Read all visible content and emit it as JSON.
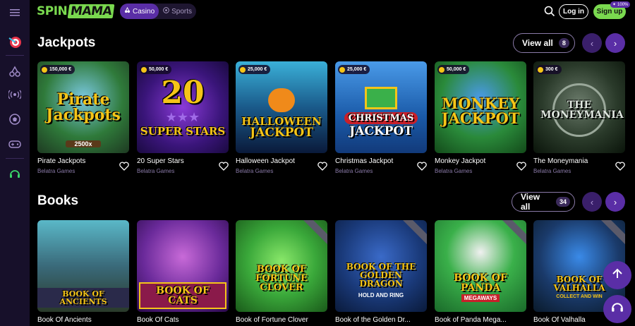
{
  "header": {
    "logo": {
      "part1": "SPIN",
      "part2": "MAMA"
    },
    "tabs": [
      {
        "label": "Casino",
        "icon": "casino-icon",
        "active": true
      },
      {
        "label": "Sports",
        "icon": "soccer-ball-icon",
        "active": false
      }
    ],
    "login_label": "Log in",
    "signup_label": "Sign up",
    "signup_badge": "100%"
  },
  "sidebar": {
    "items": [
      {
        "icon": "menu-icon"
      },
      {
        "icon": "target-icon"
      },
      {
        "icon": "cherries-icon"
      },
      {
        "icon": "live-broadcast-icon"
      },
      {
        "icon": "soccer-ball-icon"
      },
      {
        "icon": "gamepad-icon"
      },
      {
        "icon": "headset-icon"
      }
    ]
  },
  "sections": [
    {
      "title": "Jackpots",
      "view_all_label": "View all",
      "count": "8",
      "games": [
        {
          "name": "Pirate Jackpots",
          "provider": "Belatra Games",
          "jackpot": "150,000 €",
          "art_title": "Pirate Jackpots",
          "art_sub": "2500x"
        },
        {
          "name": "20 Super Stars",
          "provider": "Belatra Games",
          "jackpot": "50,000 €",
          "art_title": "20",
          "art_sub": "SUPER STARS"
        },
        {
          "name": "Halloween Jackpot",
          "provider": "Belatra Games",
          "jackpot": "25,000 €",
          "art_title": "HALLOWEEN",
          "art_sub": "JACKPOT"
        },
        {
          "name": "Christmas Jackpot",
          "provider": "Belatra Games",
          "jackpot": "25,000 €",
          "art_title": "CHRISTMAS",
          "art_sub": "JACKPOT"
        },
        {
          "name": "Monkey Jackpot",
          "provider": "Belatra Games",
          "jackpot": "50,000 €",
          "art_title": "MONKEY",
          "art_sub": "JACKPOT"
        },
        {
          "name": "The Moneymania",
          "provider": "Belatra Games",
          "jackpot": "300 €",
          "art_title": "THE MONEYMANIA",
          "art_sub": ""
        }
      ]
    },
    {
      "title": "Books",
      "view_all_label": "View all",
      "count": "34",
      "games": [
        {
          "name": "Book Of Ancients",
          "art_title": "BOOK OF ANCIENTS"
        },
        {
          "name": "Book Of Cats",
          "art_title": "BOOK OF CATS"
        },
        {
          "name": "Book of Fortune Clover",
          "art_title": "BOOK OF FORTUNE CLOVER"
        },
        {
          "name": "Book of the Golden Dr...",
          "art_title": "BOOK OF THE GOLDEN DRAGON",
          "art_sub": "HOLD AND RING"
        },
        {
          "name": "Book of Panda Mega...",
          "art_title": "BOOK OF PANDA",
          "art_sub": "MEGAWAYS"
        },
        {
          "name": "Book Of Valhalla",
          "art_title": "BOOK OF VALHALLA",
          "art_sub": "COLLECT AND WIN"
        }
      ]
    }
  ],
  "colors": {
    "accent_green": "#7ad94f",
    "accent_purple": "#5a2ea6",
    "sidebar_bg": "#17102a"
  }
}
